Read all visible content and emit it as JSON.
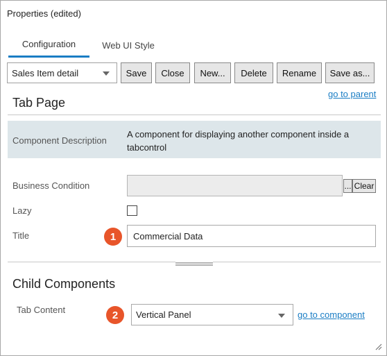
{
  "window": {
    "title": "Properties (edited)"
  },
  "tabs": [
    {
      "label": "Configuration",
      "active": true
    },
    {
      "label": "Web UI Style",
      "active": false
    }
  ],
  "toolbar": {
    "selected": "Sales Item detail",
    "buttons": [
      "Save",
      "Close",
      "New...",
      "Delete",
      "Rename",
      "Save as..."
    ]
  },
  "links": {
    "go_to_parent": "go to parent",
    "go_to_component": "go to component"
  },
  "tab_page": {
    "title": "Tab Page",
    "component_description_label": "Component Description",
    "component_description": "A component for displaying another component inside a tabcontrol",
    "business_condition_label": "Business Condition",
    "business_condition_value": "",
    "browse_label": "...",
    "clear_label": "Clear",
    "lazy_label": "Lazy",
    "lazy_checked": false,
    "title_label": "Title",
    "title_value": "Commercial Data"
  },
  "child_components": {
    "title": "Child Components",
    "tab_content_label": "Tab Content",
    "tab_content_value": "Vertical Panel"
  },
  "badges": [
    "1",
    "2"
  ],
  "colors": {
    "accent": "#1a7dc4",
    "badge": "#e8552a",
    "desc_bg": "#dde6ea"
  },
  "icons": {
    "dropdown": "chevron-down-icon",
    "resize": "resize-grip-icon"
  }
}
